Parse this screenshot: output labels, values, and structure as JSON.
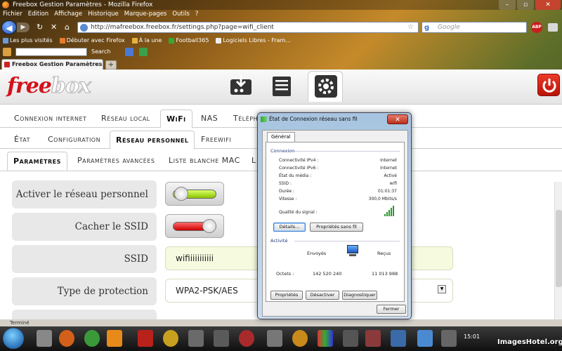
{
  "window": {
    "title": "Freebox Gestion Paramètres - Mozilla Firefox"
  },
  "menu": [
    "Fichier",
    "Edition",
    "Affichage",
    "Historique",
    "Marque-pages",
    "Outils",
    "?"
  ],
  "nav": {
    "url": "http://mafreebox.freebox.fr/settings.php?page=wifi_client",
    "search_placeholder": "Google",
    "search_engine_glyph": "g",
    "abp_label": "ABP"
  },
  "bookmarks": [
    "Les plus visités",
    "Débuter avec Firefox",
    "À la une",
    "Football365",
    "Logiciels Libres - Fram..."
  ],
  "extrabar": {
    "search_label": "Search"
  },
  "tab": {
    "label": "Freebox Gestion Paramètres",
    "close": "×",
    "new": "+"
  },
  "freebox": {
    "logo_free": "free",
    "logo_box": "box",
    "nav1": [
      "Connexion internet",
      "Réseau local",
      "WiFi",
      "NAS",
      "Télépho"
    ],
    "nav1_active": "WiFi",
    "nav2": [
      "État",
      "Configuration",
      "Réseau personnel",
      "Freewifi"
    ],
    "nav2_active": "Réseau personnel",
    "nav3": [
      "Paramètres",
      "Paramètres avancées",
      "Liste blanche MAC",
      "L"
    ],
    "nav3_active": "Paramètres",
    "form": [
      {
        "label": "Activer le réseau personnel",
        "type": "toggle",
        "state": "on"
      },
      {
        "label": "Cacher le SSID",
        "type": "toggle",
        "state": "off"
      },
      {
        "label": "SSID",
        "type": "text",
        "value": "wifiiiiiiiiiii"
      },
      {
        "label": "Type de protection",
        "type": "select",
        "value": "WPA2-PSK/AES"
      }
    ]
  },
  "dialog": {
    "title": "État de Connexion réseau sans fil",
    "tab": "Général",
    "connexion_title": "Connexion",
    "rows": [
      {
        "k": "Connectivité IPv4 :",
        "v": "Internet"
      },
      {
        "k": "Connectivité IPv6 :",
        "v": "Internet"
      },
      {
        "k": "État du média :",
        "v": "Activé"
      },
      {
        "k": "SSID :",
        "v": "wifi"
      },
      {
        "k": "Durée :",
        "v": "01:01:37"
      },
      {
        "k": "Vitesse :",
        "v": "300,0 Mbits/s"
      }
    ],
    "signal_label": "Qualité du signal :",
    "signal_level": 5,
    "btn_details": "Détails...",
    "btn_wifi_props": "Propriétés sans fil",
    "activity_title": "Activité",
    "sent_label": "Envoyés",
    "received_label": "Reçus",
    "octets_label": "Octets :",
    "octets_sent": "142 520 240",
    "octets_received": "11 013 988",
    "btn_properties": "Propriétés",
    "btn_disable": "Désactiver",
    "btn_diagnose": "Diagnostiquer",
    "btn_close": "Fermer"
  },
  "statusbar": {
    "text": "Terminé"
  },
  "taskbar": {
    "clock": "15:01"
  },
  "watermark": "ImagesHotel.org"
}
